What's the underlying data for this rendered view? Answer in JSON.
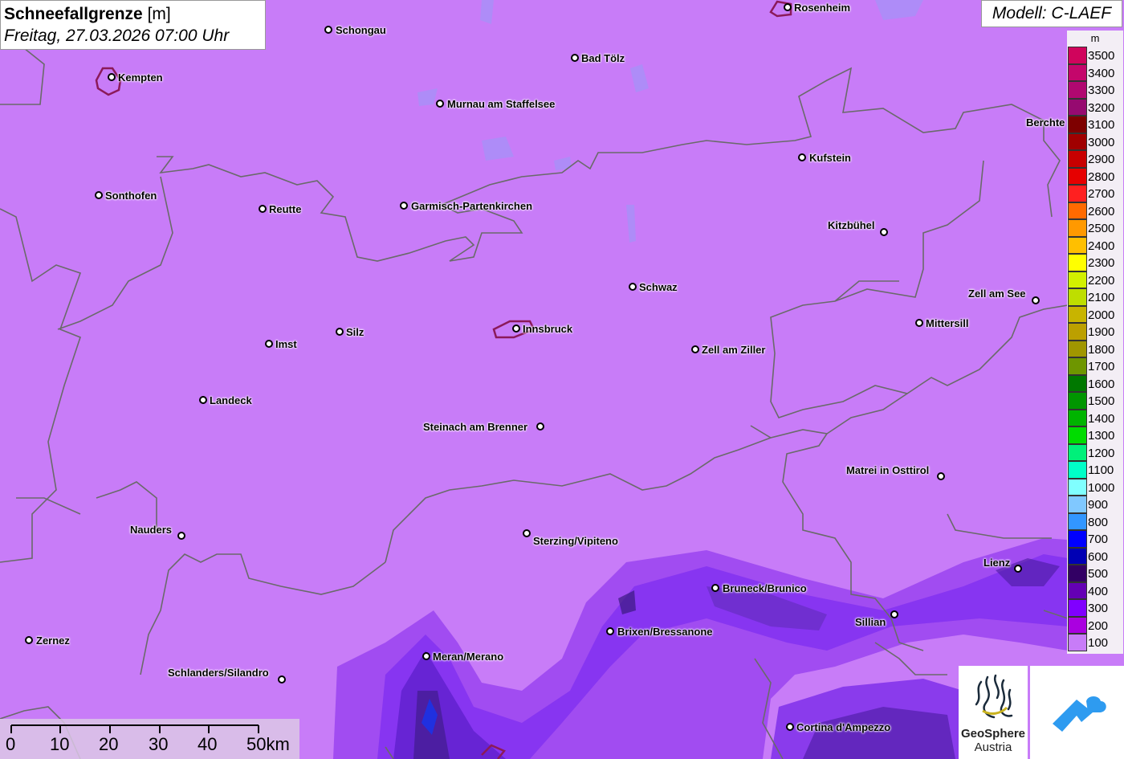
{
  "title": {
    "bold": "Schneefallgrenze",
    "unit": " [m]",
    "subtitle": "Freitag, 27.03.2026 07:00 Uhr"
  },
  "model": "Modell: C-LAEF",
  "legend": {
    "unit": "m",
    "entries": [
      {
        "label": "3500",
        "color": "#d0045c"
      },
      {
        "label": "3400",
        "color": "#c4066b"
      },
      {
        "label": "3300",
        "color": "#b00870"
      },
      {
        "label": "3200",
        "color": "#960a70"
      },
      {
        "label": "3100",
        "color": "#7e0000"
      },
      {
        "label": "3000",
        "color": "#a00000"
      },
      {
        "label": "2900",
        "color": "#c80000"
      },
      {
        "label": "2800",
        "color": "#e60000"
      },
      {
        "label": "2700",
        "color": "#ff2020"
      },
      {
        "label": "2600",
        "color": "#ff6a00"
      },
      {
        "label": "2500",
        "color": "#ff9900"
      },
      {
        "label": "2400",
        "color": "#ffbf00"
      },
      {
        "label": "2300",
        "color": "#ffff00"
      },
      {
        "label": "2200",
        "color": "#d2f000"
      },
      {
        "label": "2100",
        "color": "#bede00"
      },
      {
        "label": "2000",
        "color": "#c8b400"
      },
      {
        "label": "1900",
        "color": "#bca000"
      },
      {
        "label": "1800",
        "color": "#a09600"
      },
      {
        "label": "1700",
        "color": "#6e9600"
      },
      {
        "label": "1600",
        "color": "#007800"
      },
      {
        "label": "1500",
        "color": "#009600"
      },
      {
        "label": "1400",
        "color": "#00b400"
      },
      {
        "label": "1300",
        "color": "#00dc00"
      },
      {
        "label": "1200",
        "color": "#00f07a"
      },
      {
        "label": "1100",
        "color": "#00ffc8"
      },
      {
        "label": "1000",
        "color": "#80ffff"
      },
      {
        "label": "900",
        "color": "#80c8ff"
      },
      {
        "label": "800",
        "color": "#3296ff"
      },
      {
        "label": "700",
        "color": "#0000ff"
      },
      {
        "label": "600",
        "color": "#0000b4"
      },
      {
        "label": "500",
        "color": "#320064"
      },
      {
        "label": "400",
        "color": "#6400b4"
      },
      {
        "label": "300",
        "color": "#8000ff"
      },
      {
        "label": "200",
        "color": "#aa00e0"
      },
      {
        "label": "100",
        "color": "#c87cf8"
      }
    ]
  },
  "places": [
    {
      "name": "Rosenheim"
    },
    {
      "name": "Schongau"
    },
    {
      "name": "Bad Tölz"
    },
    {
      "name": "Kempten"
    },
    {
      "name": "Murnau am Staffelsee"
    },
    {
      "name": "Berchte"
    },
    {
      "name": "Kufstein"
    },
    {
      "name": "Sonthofen"
    },
    {
      "name": "Reutte"
    },
    {
      "name": "Garmisch-Partenkirchen"
    },
    {
      "name": "Kitzbühel"
    },
    {
      "name": "Schwaz"
    },
    {
      "name": "Zell am See"
    },
    {
      "name": "Mittersill"
    },
    {
      "name": "Innsbruck"
    },
    {
      "name": "Silz"
    },
    {
      "name": "Imst"
    },
    {
      "name": "Zell am Ziller"
    },
    {
      "name": "Landeck"
    },
    {
      "name": "Steinach am Brenner"
    },
    {
      "name": "Matrei in Osttirol"
    },
    {
      "name": "Nauders"
    },
    {
      "name": "Sterzing/Vipiteno"
    },
    {
      "name": "Lienz"
    },
    {
      "name": "Bruneck/Brunico"
    },
    {
      "name": "Sillian"
    },
    {
      "name": "Brixen/Bressanone"
    },
    {
      "name": "Zernez"
    },
    {
      "name": "Meran/Merano"
    },
    {
      "name": "Schlanders/Silandro"
    },
    {
      "name": "Cortina d'Ampezzo"
    }
  ],
  "scale": [
    "0",
    "10",
    "20",
    "30",
    "40",
    "50km"
  ],
  "logos": {
    "geosphere_line1": "GeoSphere",
    "geosphere_line2": "Austria"
  },
  "colors": {
    "map_base": "#c87cf8",
    "border": "#6a6a6a"
  }
}
